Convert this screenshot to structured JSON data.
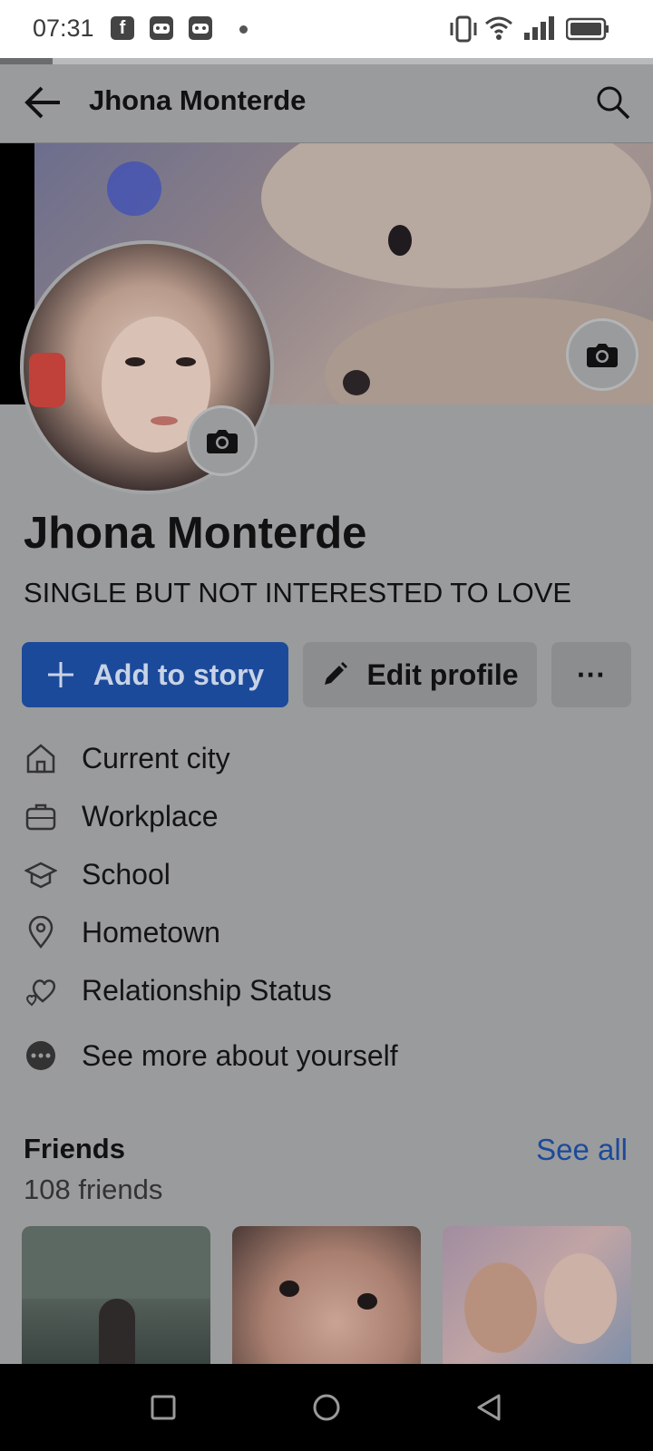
{
  "status_bar": {
    "time": "07:31",
    "notification_icons": [
      "facebook-icon",
      "game-controller-icon",
      "game-controller-icon",
      "dot-icon"
    ],
    "system_icons": [
      "vibrate-icon",
      "wifi-icon",
      "signal-icon",
      "battery-icon"
    ]
  },
  "loading_progress": 0.08,
  "top_bar": {
    "title": "Jhona Monterde",
    "back_icon": "arrow-left-icon",
    "search_icon": "search-icon"
  },
  "profile": {
    "name": "Jhona Monterde",
    "bio": "SINGLE BUT NOT INTERESTED TO LOVE"
  },
  "actions": {
    "add_story": "Add to story",
    "edit_profile": "Edit profile",
    "more": "···"
  },
  "intro": {
    "items": [
      {
        "label": "Current city",
        "icon": "home-icon"
      },
      {
        "label": "Workplace",
        "icon": "briefcase-icon"
      },
      {
        "label": "School",
        "icon": "graduation-cap-icon"
      },
      {
        "label": "Hometown",
        "icon": "location-pin-icon"
      },
      {
        "label": "Relationship Status",
        "icon": "heart-icon"
      },
      {
        "label": "See more about yourself",
        "icon": "more-dots-icon"
      }
    ]
  },
  "friends": {
    "title": "Friends",
    "see_all": "See all",
    "count": "108 friends",
    "thumbnails": 3
  },
  "nav_bar": {
    "buttons": [
      "recent-apps-icon",
      "home-circle-icon",
      "back-triangle-icon"
    ]
  },
  "colors": {
    "overlay_background": "#9a9b9d",
    "accent_blue": "#1c4a9a",
    "navbar": "#000000"
  }
}
